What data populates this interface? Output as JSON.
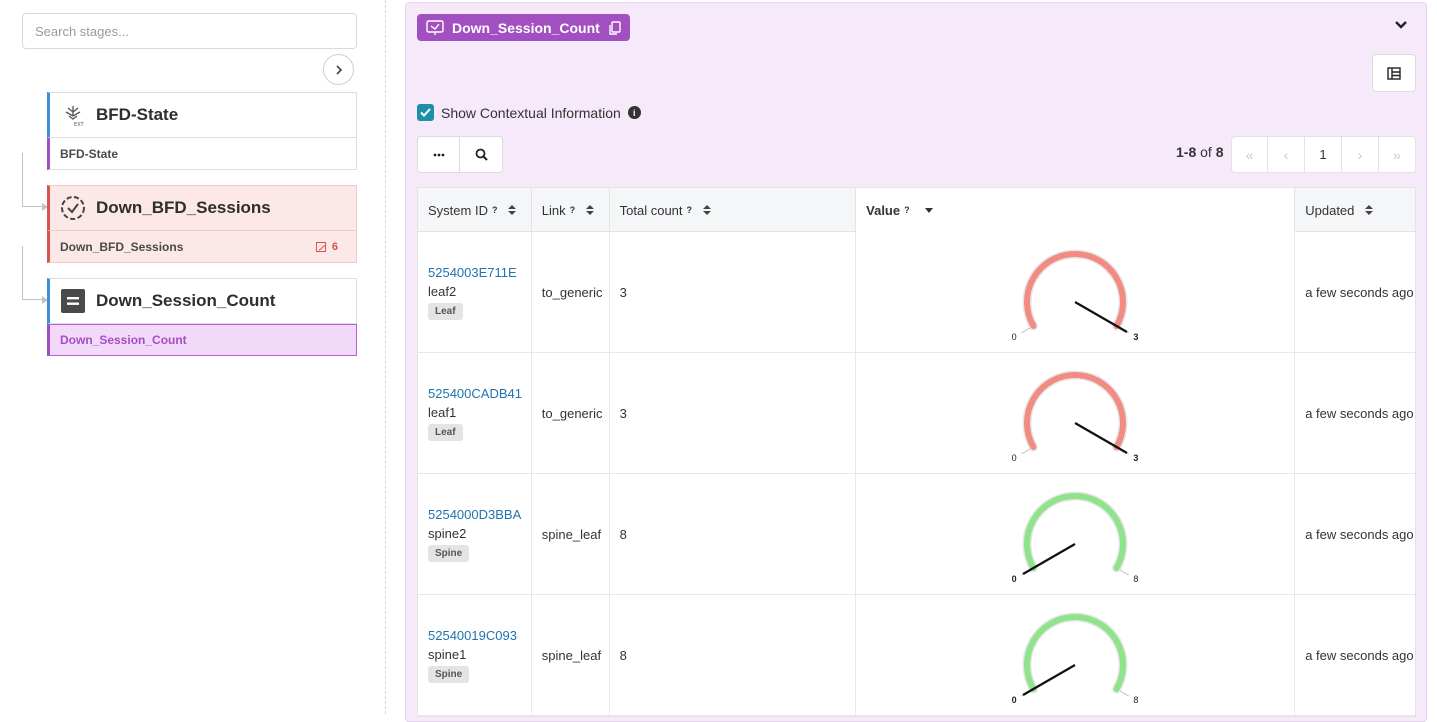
{
  "sidebar": {
    "search_placeholder": "Search stages...",
    "stages": [
      {
        "title": "BFD-State",
        "sub": "BFD-State",
        "icon": "ext-collector-icon",
        "state": "normal"
      },
      {
        "title": "Down_BFD_Sessions",
        "sub": "Down_BFD_Sessions",
        "icon": "range-check-icon",
        "state": "anomaly",
        "anomaly_count": "6"
      },
      {
        "title": "Down_Session_Count",
        "sub": "Down_Session_Count",
        "icon": "equals-icon",
        "state": "selected"
      }
    ]
  },
  "panel": {
    "stage_tag": "Down_Session_Count",
    "show_context_label": "Show Contextual Information",
    "show_context_checked": true,
    "range_text": "1-8",
    "range_of": "of",
    "range_total": "8",
    "current_page": "1",
    "table": {
      "columns": [
        "System ID",
        "Link",
        "Total count",
        "Value",
        "Updated"
      ],
      "rows": [
        {
          "system_id": "5254003E711E",
          "hostname": "leaf2",
          "role": "Leaf",
          "link": "to_generic",
          "total": "3",
          "gauge": {
            "min": "0",
            "max": "3",
            "value": 3,
            "color": "#f28b82"
          },
          "updated": "a few seconds ago"
        },
        {
          "system_id": "525400CADB41",
          "hostname": "leaf1",
          "role": "Leaf",
          "link": "to_generic",
          "total": "3",
          "gauge": {
            "min": "0",
            "max": "3",
            "value": 3,
            "color": "#f28b82"
          },
          "updated": "a few seconds ago"
        },
        {
          "system_id": "5254000D3BBA",
          "hostname": "spine2",
          "role": "Spine",
          "link": "spine_leaf",
          "total": "8",
          "gauge": {
            "min": "0",
            "max": "8",
            "value": 0,
            "color": "#8fe38a"
          },
          "updated": "a few seconds ago"
        },
        {
          "system_id": "52540019C093",
          "hostname": "spine1",
          "role": "Spine",
          "link": "spine_leaf",
          "total": "8",
          "gauge": {
            "min": "0",
            "max": "8",
            "value": 0,
            "color": "#8fe38a"
          },
          "updated": "a few seconds ago"
        }
      ]
    }
  }
}
